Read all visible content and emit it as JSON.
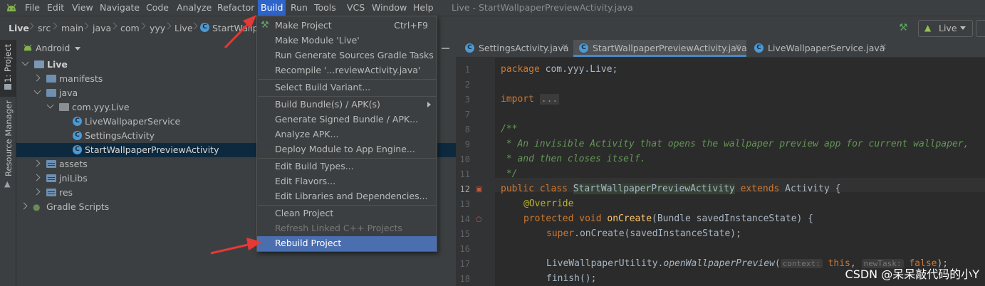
{
  "menubar": {
    "items": [
      "File",
      "Edit",
      "View",
      "Navigate",
      "Code",
      "Analyze",
      "Refactor",
      "Build",
      "Run",
      "Tools",
      "VCS",
      "Window",
      "Help"
    ],
    "active": "Build",
    "window_title": "Live - StartWallpaperPreviewActivity.java"
  },
  "breadcrumb": {
    "items": [
      "Live",
      "src",
      "main",
      "java",
      "com",
      "yyy",
      "Live",
      "StartWallpa"
    ]
  },
  "toolbar": {
    "run_config": "Live"
  },
  "left_strip": {
    "project_tab": "1: Project",
    "resource_tab": "Resource Manager"
  },
  "project": {
    "view_selector": "Android",
    "tree": [
      {
        "label": "Live",
        "level": 0,
        "type": "module",
        "expanded": true
      },
      {
        "label": "manifests",
        "level": 1,
        "type": "folder",
        "expanded": false
      },
      {
        "label": "java",
        "level": 1,
        "type": "folder",
        "expanded": true
      },
      {
        "label": "com.yyy.Live",
        "level": 2,
        "type": "package",
        "expanded": true
      },
      {
        "label": "LiveWallpaperService",
        "level": 3,
        "type": "class"
      },
      {
        "label": "SettingsActivity",
        "level": 3,
        "type": "class"
      },
      {
        "label": "StartWallpaperPreviewActivity",
        "level": 3,
        "type": "class",
        "selected": true
      },
      {
        "label": "assets",
        "level": 1,
        "type": "resfolder",
        "expanded": false
      },
      {
        "label": "jniLibs",
        "level": 1,
        "type": "resfolder",
        "expanded": false
      },
      {
        "label": "res",
        "level": 1,
        "type": "resfolder",
        "expanded": false
      },
      {
        "label": "Gradle Scripts",
        "level": 0,
        "type": "gradle",
        "expanded": false
      }
    ]
  },
  "build_menu": {
    "groups": [
      [
        {
          "label": "Make Project",
          "shortcut": "Ctrl+F9",
          "icon": "hammer-icon"
        },
        {
          "label": "Make Module 'Live'"
        },
        {
          "label": "Run Generate Sources Gradle Tasks"
        },
        {
          "label": "Recompile '...reviewActivity.java'"
        }
      ],
      [
        {
          "label": "Select Build Variant..."
        }
      ],
      [
        {
          "label": "Build Bundle(s) / APK(s)",
          "submenu": true
        },
        {
          "label": "Generate Signed Bundle / APK..."
        },
        {
          "label": "Analyze APK..."
        },
        {
          "label": "Deploy Module to App Engine..."
        }
      ],
      [
        {
          "label": "Edit Build Types..."
        },
        {
          "label": "Edit Flavors..."
        },
        {
          "label": "Edit Libraries and Dependencies..."
        }
      ],
      [
        {
          "label": "Clean Project"
        },
        {
          "label": "Refresh Linked C++ Projects",
          "disabled": true
        },
        {
          "label": "Rebuild Project",
          "highlighted": true
        }
      ]
    ]
  },
  "editor": {
    "tabs": [
      {
        "label": "SettingsActivity.java",
        "active": false
      },
      {
        "label": "StartWallpaperPreviewActivity.java",
        "active": true
      },
      {
        "label": "LiveWallpaperService.java",
        "active": false
      }
    ],
    "line_numbers": [
      "1",
      "2",
      "3",
      "7",
      "8",
      "9",
      "10",
      "11",
      "12",
      "13",
      "14",
      "15",
      "16",
      "17",
      "18"
    ],
    "code": {
      "l1_kw": "package",
      "l1_rest": " com.yyy.Live;",
      "l3_kw": "import",
      "l3_fold": "...",
      "l8": "/**",
      "l9": " * An invisible Activity that opens the wallpaper preview app for current wallpaper,",
      "l10": " * and then closes itself.",
      "l11": " */",
      "l12_kw1": "public class",
      "l12_cls": "StartWallpaperPreviewActivity",
      "l12_kw2": "extends",
      "l12_rest": " Activity {",
      "l13": "@Override",
      "l14_kw": "protected void",
      "l14_fn": "onCreate",
      "l14_rest": "(Bundle savedInstanceState) {",
      "l15_kw": "super",
      "l15_rest": ".onCreate(savedInstanceState);",
      "l17_a": "LiveWallpaperUtility.",
      "l17_fn": "openWallpaperPreview",
      "l17_b": "(",
      "l17_hint1": "context:",
      "l17_kw1": "this",
      "l17_c": ", ",
      "l17_hint2": "newTask:",
      "l17_kw2": "false",
      "l17_d": ");",
      "l18": "finish();"
    }
  },
  "watermark": "CSDN @呆呆敲代码的小Y",
  "colors": {
    "accent": "#4b6eaf",
    "annotation_arrow": "#e53935"
  }
}
